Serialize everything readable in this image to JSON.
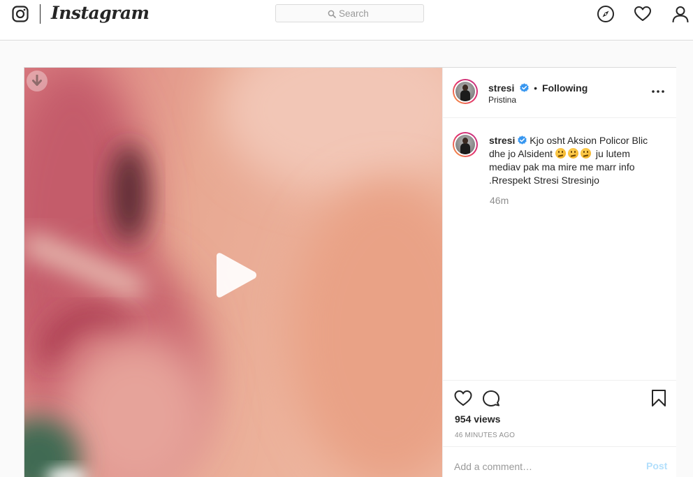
{
  "header": {
    "brand": "Instagram",
    "search_placeholder": "Search",
    "icons": [
      "instagram-glyph-icon",
      "search-icon",
      "compass-icon",
      "heart-icon",
      "profile-icon"
    ]
  },
  "post": {
    "username": "stresi",
    "verified": true,
    "follow_state": "Following",
    "location": "Pristina",
    "caption": {
      "username": "stresi",
      "line1": "Kjo osht Aksion Policor Blic",
      "line2_start": "dhe jo Alsident",
      "line2_end": "ju lutem",
      "line3": "mediav pak ma mire me marr info",
      "line4": ".Rrespekt Stresi Stresinjo",
      "emoji_count": 3,
      "time_ago": "46m"
    },
    "views": "954 views",
    "timestamp": "46 MINUTES AGO",
    "comment_placeholder": "Add a comment…",
    "post_button": "Post"
  },
  "colors": {
    "border": "#dbdbdb",
    "verified": "#3897f0",
    "muted": "#8e8e8e",
    "post_disabled": "#b2dffc"
  }
}
